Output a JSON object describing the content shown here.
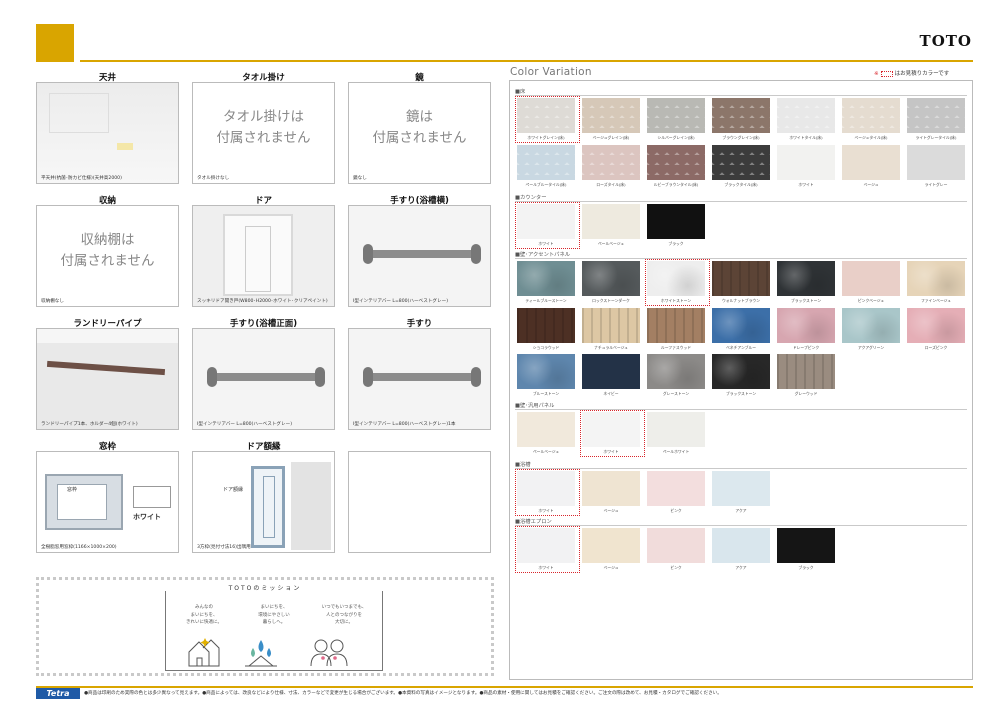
{
  "brand": {
    "logo": "TOTO",
    "accent": "#d9a500",
    "footer_blue": "#1f5aa6",
    "swatch_highlight": "#d8252b"
  },
  "items": [
    {
      "title": "天井",
      "caption": "平天井(抗菌･防カビ仕様)(天井高2000)",
      "na": ""
    },
    {
      "title": "タオル掛け",
      "caption": "タオル掛けなし",
      "na": "タオル掛けは\n付属されません"
    },
    {
      "title": "鏡",
      "caption": "鏡なし",
      "na": "鏡は\n付属されません"
    },
    {
      "title": "収納",
      "caption": "収納棚なし",
      "na": "収納棚は\n付属されません"
    },
    {
      "title": "ドア",
      "caption": "スッキリドア開き戸(W800･H2000･ホワイト･クリアペイント)",
      "na": ""
    },
    {
      "title": "手すり(浴槽横)",
      "caption": "I型インテリアバー L=800(ハーベストグレー)",
      "na": ""
    },
    {
      "title": "ランドリーパイプ",
      "caption": "ランドリーパイプ1本、ホルダー4個(ホワイト)",
      "na": ""
    },
    {
      "title": "手すり(浴槽正面)",
      "caption": "I型インテリアバー L=800(ハーベストグレー)",
      "na": ""
    },
    {
      "title": "手すり",
      "caption": "I型インテリアバー L=800(ハーベストグレー)1本",
      "na": ""
    },
    {
      "title": "窓枠",
      "caption": "全樹脂窓用窓枠(1166×1000×200)",
      "na": "",
      "swatch_label": "ホワイト",
      "callout": "窓枠"
    },
    {
      "title": "ドア額縁",
      "caption": "3方枠(見付寸法16)出隅用",
      "na": "",
      "callout": "ドア額縁"
    },
    {
      "title": "",
      "caption": "",
      "na": ""
    }
  ],
  "mission": {
    "title": "TOTOのミッション",
    "texts": [
      "みんなの\nまいにちを、\nきれいに快適に。",
      "まいにちを、\n環境にやさしい\n暮らしへ。",
      "いつでもいつまでも、\n人とのつながりを\n大切に。"
    ]
  },
  "color_variation": {
    "title": "Color Variation",
    "note_prefix": "※",
    "note_suffix": "はお見積りカラーです",
    "sections": [
      {
        "label": "■床",
        "selected": 0,
        "rows": [
          [
            {
              "name": "ホワイトグレイン(床)",
              "color": "#dedbd6",
              "tex": "tile"
            },
            {
              "name": "ベージュグレイン(床)",
              "color": "#d6c8b8",
              "tex": "tile"
            },
            {
              "name": "シルバーグレイン(床)",
              "color": "#b9b9b4",
              "tex": "tile"
            },
            {
              "name": "ブラウングレイン(床)",
              "color": "#8c766a",
              "tex": "tile"
            },
            {
              "name": "ホワイトタイル(床)",
              "color": "#e8e8e8",
              "tex": "tile"
            },
            {
              "name": "ベージュタイル(床)",
              "color": "#e5dcd0",
              "tex": "tile"
            },
            {
              "name": "ライトグレータイル(床)",
              "color": "#c5c5c5",
              "tex": "tile"
            }
          ],
          [
            {
              "name": "ペールブルータイル(床)",
              "color": "#c9d8e2",
              "tex": "tile"
            },
            {
              "name": "ローズタイル(床)",
              "color": "#dcc5c0",
              "tex": "tile"
            },
            {
              "name": "ルビーブラウンタイル(床)",
              "color": "#8c6a66",
              "tex": "tile"
            },
            {
              "name": "ブラックタイル(床)",
              "color": "#3c3c3c",
              "tex": "tile"
            },
            {
              "name": "ホワイト",
              "color": "#f2f2f0",
              "tex": "plain"
            },
            {
              "name": "ベージュ",
              "color": "#e9dfd2",
              "tex": "plain"
            },
            {
              "name": "ライトグレー",
              "color": "#dbdbdb",
              "tex": "plain"
            }
          ]
        ]
      },
      {
        "label": "■カウンター",
        "selected": 0,
        "rows": [
          [
            {
              "name": "ホワイト",
              "color": "#f3f3f3",
              "tex": "plain"
            },
            {
              "name": "ペールベージュ",
              "color": "#eeeadf",
              "tex": "plain"
            },
            {
              "name": "ブラック",
              "color": "#111111",
              "tex": "plain"
            }
          ]
        ]
      },
      {
        "label": "■壁･アクセントパネル",
        "selected": 2,
        "rows": [
          [
            {
              "name": "ティールブルーストーン",
              "color": "#6f8e93",
              "tex": "stone"
            },
            {
              "name": "ロックストーンダーク",
              "color": "#555a5c",
              "tex": "stone"
            },
            {
              "name": "ホワイトストーン",
              "color": "#eeeeee",
              "tex": "stone"
            },
            {
              "name": "ウォルナットブラウン",
              "color": "#5c4436",
              "tex": "wood"
            },
            {
              "name": "ブラックストーン",
              "color": "#2f3336",
              "tex": "stone"
            },
            {
              "name": "ピンクベージュ",
              "color": "#e9cfc8",
              "tex": "plain"
            },
            {
              "name": "ファインベージュ",
              "color": "#e6d4b8",
              "tex": "stone"
            }
          ],
          [
            {
              "name": "ショコラウッド",
              "color": "#4d3024",
              "tex": "wood"
            },
            {
              "name": "ナチュラルベージュ",
              "color": "#ddc7a4",
              "tex": "wood"
            },
            {
              "name": "ルーファスウッド",
              "color": "#a37f63",
              "tex": "wood"
            },
            {
              "name": "ベネチアンブルー",
              "color": "#3c6fa8",
              "tex": "stone"
            },
            {
              "name": "ドレープピンク",
              "color": "#d7a6b0",
              "tex": "stone"
            },
            {
              "name": "アクアグリーン",
              "color": "#a9c6c9",
              "tex": "stone"
            },
            {
              "name": "ローズピンク",
              "color": "#e5aeb6",
              "tex": "stone"
            }
          ],
          [
            {
              "name": "ブルーストーン",
              "color": "#5e86ad",
              "tex": "stone"
            },
            {
              "name": "ネイビー",
              "color": "#233247",
              "tex": "plain"
            },
            {
              "name": "グレーストーン",
              "color": "#8c8a88",
              "tex": "stone"
            },
            {
              "name": "ブラックストーン",
              "color": "#282828",
              "tex": "stone"
            },
            {
              "name": "グレーウッド",
              "color": "#9a8c80",
              "tex": "wood"
            }
          ]
        ]
      },
      {
        "label": "■壁･汎用パネル",
        "selected": 1,
        "rows": [
          [
            {
              "name": "ペールベージュ",
              "color": "#f1e9dc",
              "tex": "plain"
            },
            {
              "name": "ホワイト",
              "color": "#f4f4f4",
              "tex": "plain"
            },
            {
              "name": "ペールホワイト",
              "color": "#eeeeea",
              "tex": "plain"
            }
          ]
        ]
      },
      {
        "label": "■浴槽",
        "selected": 0,
        "rows": [
          [
            {
              "name": "ホワイト",
              "color": "#f2f2f3",
              "tex": "plain"
            },
            {
              "name": "ベージュ",
              "color": "#efe4d2",
              "tex": "plain"
            },
            {
              "name": "ピンク",
              "color": "#f3dede",
              "tex": "plain"
            },
            {
              "name": "アクア",
              "color": "#dce8ee",
              "tex": "plain"
            }
          ]
        ]
      },
      {
        "label": "■浴槽エプロン",
        "selected": 0,
        "rows": [
          [
            {
              "name": "ホワイト",
              "color": "#f2f2f3",
              "tex": "plain"
            },
            {
              "name": "ベージュ",
              "color": "#f0e4cf",
              "tex": "plain"
            },
            {
              "name": "ピンク",
              "color": "#f1dcdb",
              "tex": "plain"
            },
            {
              "name": "アクア",
              "color": "#d9e6ed",
              "tex": "plain"
            },
            {
              "name": "ブラック",
              "color": "#151515",
              "tex": "plain"
            }
          ]
        ]
      }
    ]
  },
  "footer": {
    "badge": "Tetra",
    "disclaimer": "●商品は印刷のため実際の色とは多少異なって見えます。●商品によっては、改良などにより仕様、寸法、カラーなどで変更が生じる場合がございます。●本資料の写真はイメージとなります。●商品の素材・使用に関してはお見積をご確認ください。ご注文の際は改めて、お見積・カタログでご確認ください。"
  }
}
